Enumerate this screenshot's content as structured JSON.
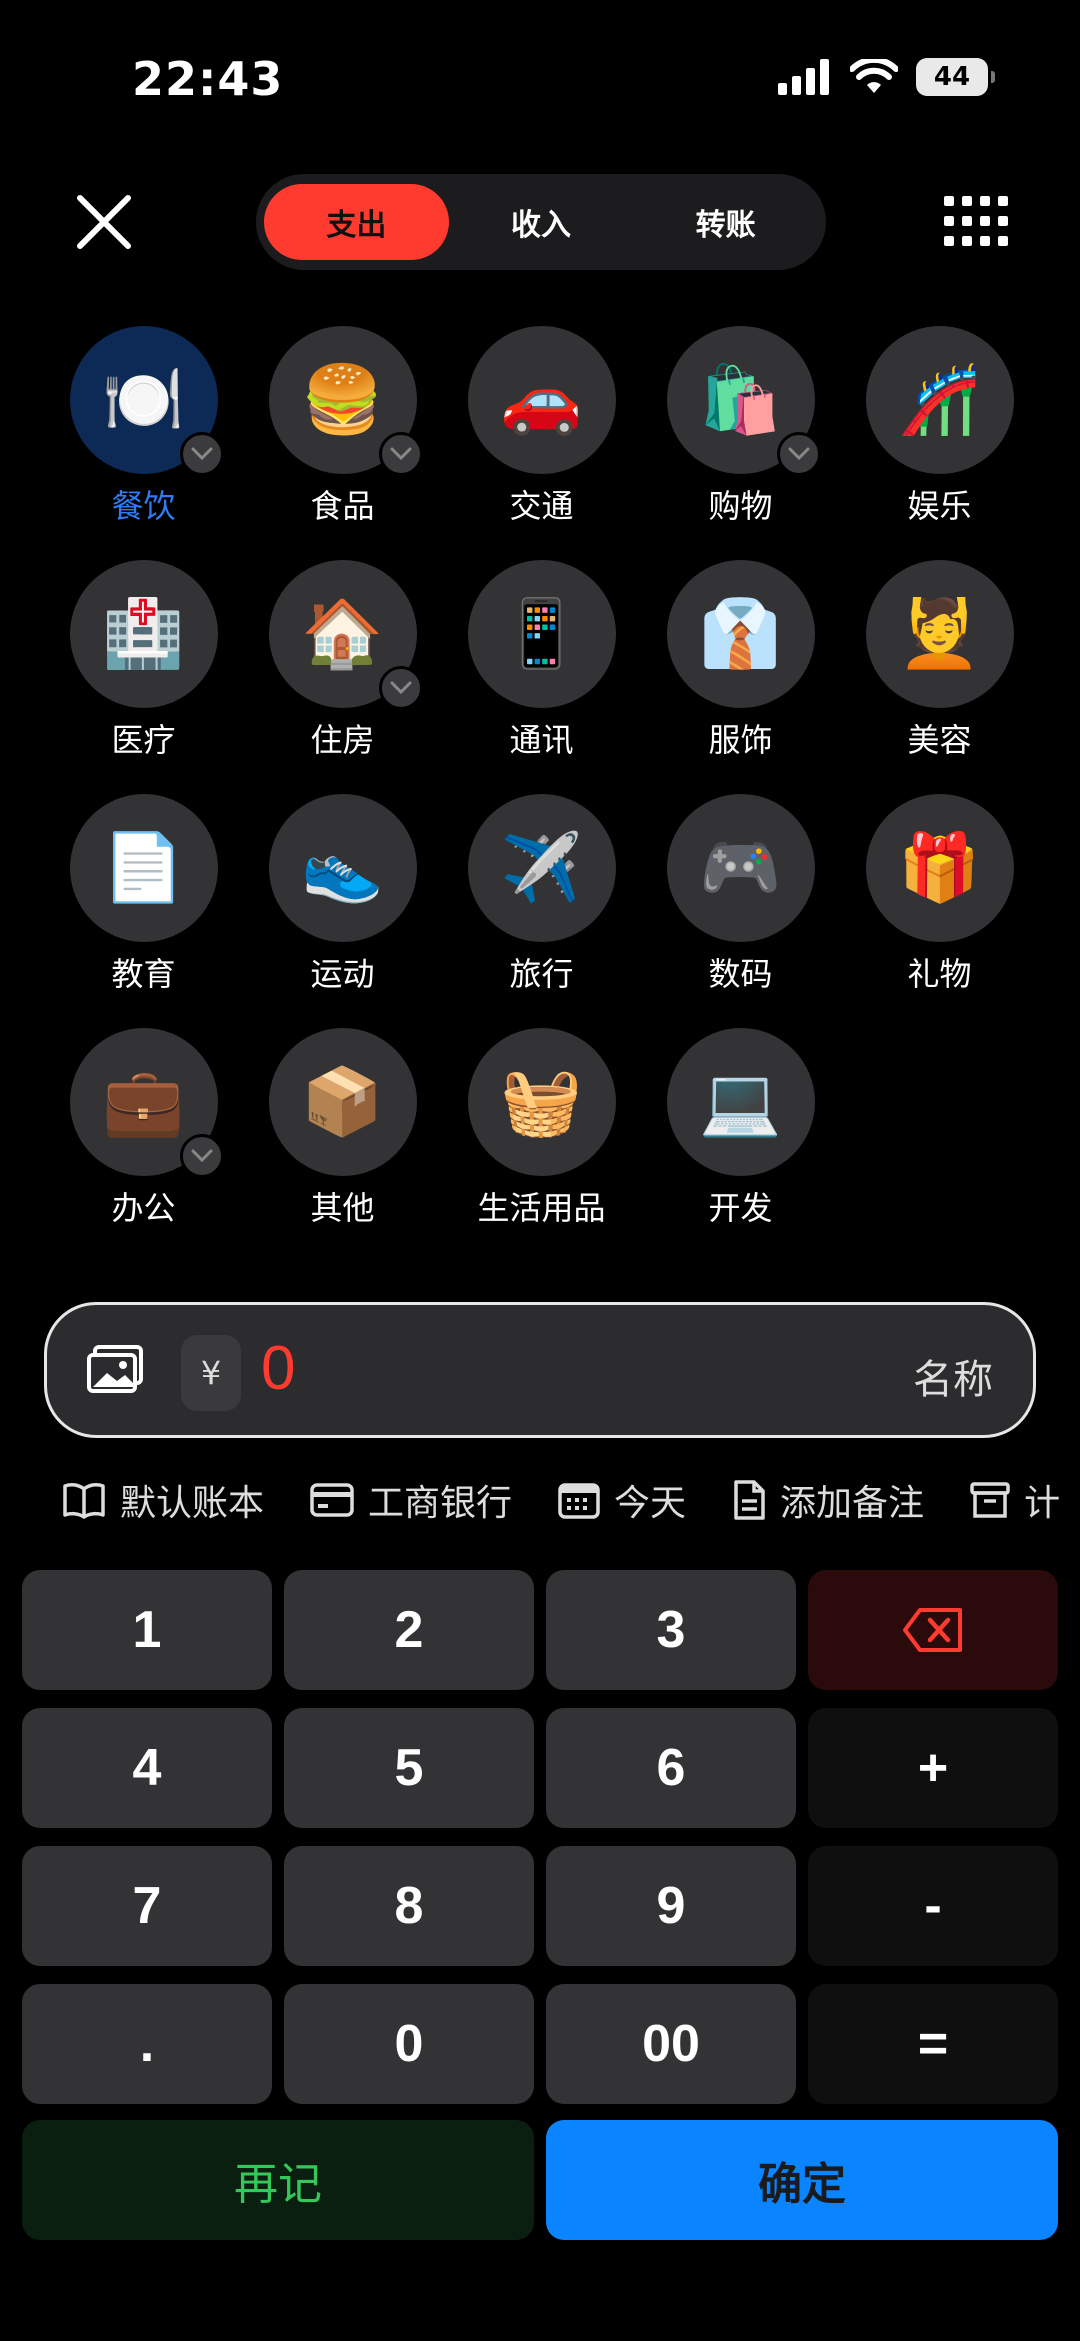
{
  "status_bar": {
    "time": "22:43",
    "battery": "44"
  },
  "header": {
    "tabs": [
      {
        "label": "支出",
        "active": true
      },
      {
        "label": "收入",
        "active": false
      },
      {
        "label": "转账",
        "active": false
      }
    ]
  },
  "categories": [
    {
      "label": "餐饮",
      "icon": "🍽️",
      "active": true,
      "has_sub": true
    },
    {
      "label": "食品",
      "icon": "🍔",
      "has_sub": true
    },
    {
      "label": "交通",
      "icon": "🚗"
    },
    {
      "label": "购物",
      "icon": "🛍️",
      "has_sub": true
    },
    {
      "label": "娱乐",
      "icon": "🎢"
    },
    {
      "label": "医疗",
      "icon": "🏥"
    },
    {
      "label": "住房",
      "icon": "🏠",
      "has_sub": true
    },
    {
      "label": "通讯",
      "icon": "📱"
    },
    {
      "label": "服饰",
      "icon": "👔"
    },
    {
      "label": "美容",
      "icon": "💆"
    },
    {
      "label": "教育",
      "icon": "📄"
    },
    {
      "label": "运动",
      "icon": "👟"
    },
    {
      "label": "旅行",
      "icon": "✈️"
    },
    {
      "label": "数码",
      "icon": "🎮"
    },
    {
      "label": "礼物",
      "icon": "🎁"
    },
    {
      "label": "办公",
      "icon": "💼",
      "has_sub": true
    },
    {
      "label": "其他",
      "icon": "📦"
    },
    {
      "label": "生活用品",
      "icon": "🧺"
    },
    {
      "label": "开发",
      "icon": "💻"
    }
  ],
  "amount": {
    "currency": "¥",
    "value": "0",
    "name_placeholder": "名称"
  },
  "options": {
    "book": "默认账本",
    "account": "工商银行",
    "date": "今天",
    "note": "添加备注",
    "more": "计"
  },
  "keypad": {
    "keys": [
      "1",
      "2",
      "3",
      "⌫",
      "4",
      "5",
      "6",
      "+",
      "7",
      "8",
      "9",
      "-",
      ".",
      "0",
      "00",
      "="
    ]
  },
  "actions": {
    "again": "再记",
    "confirm": "确定"
  },
  "colors": {
    "expense": "#ff3b30",
    "accent": "#0a84ff",
    "active_label": "#2f7bf5",
    "again": "#34c759"
  }
}
